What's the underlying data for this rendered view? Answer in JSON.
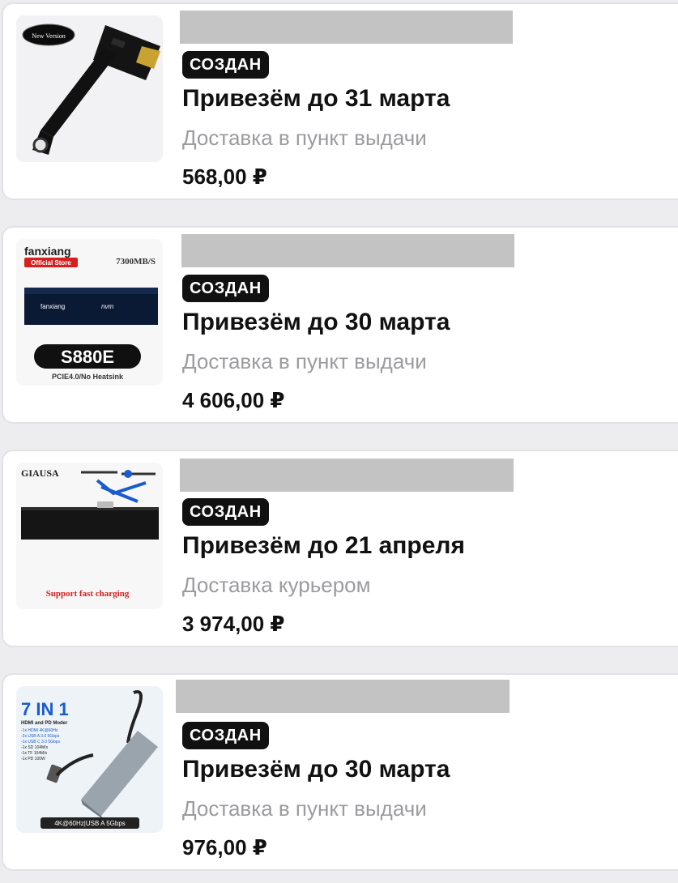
{
  "orders": [
    {
      "status": "СОЗДАН",
      "delivery_date": "Привезём до 31 марта",
      "delivery_method": "Доставка в пункт выдачи",
      "price": "568,00 ₽",
      "image": {
        "badge_text": "New Version",
        "icon": "ssd-adapter-cable-image"
      }
    },
    {
      "status": "СОЗДАН",
      "delivery_date": "Привезём до 30 марта",
      "delivery_method": "Доставка в пункт выдачи",
      "price": "4 606,00 ₽",
      "image": {
        "brand": "fanxiang",
        "store_label": "Official Store",
        "speed": "7300MB/S",
        "board_brand": "fanxiang",
        "board_label": "nvm",
        "model": "S880E",
        "spec": "PCIE4.0/No Heatsink",
        "icon": "nvme-ssd-image"
      }
    },
    {
      "status": "СОЗДАН",
      "delivery_date": "Привезём до 21 апреля",
      "delivery_method": "Доставка курьером",
      "price": "3 974,00 ₽",
      "image": {
        "brand": "GIAUSA",
        "caption": "Support fast charging",
        "icon": "laptop-battery-image"
      }
    },
    {
      "status": "СОЗДАН",
      "delivery_date": "Привезём до 30 марта",
      "delivery_method": "Доставка в пункт выдачи",
      "price": "976,00 ₽",
      "image": {
        "headline": "7 IN 1",
        "subheadline": "HDMI and PD Moder",
        "features": [
          "-1x HDMI 4K@60Hz",
          "-2x USB A 3.0 5Gbps",
          "-1x USB C 3.0 5Gbps",
          "-1x SD 104M/s",
          "-1x TF 104M/s",
          "-1x PD 100W"
        ],
        "footer": "4K@60Hz|USB A 5Gbps",
        "icon": "usb-c-hub-image"
      }
    }
  ],
  "colors": {
    "page_background": "#ededf0",
    "card_background": "#ffffff",
    "badge_background": "#111111",
    "badge_text": "#ffffff",
    "secondary_text": "#9b9ba0",
    "redaction": "#c3c3c3",
    "accent_red": "#d62020",
    "accent_blue": "#1a5ccc"
  }
}
